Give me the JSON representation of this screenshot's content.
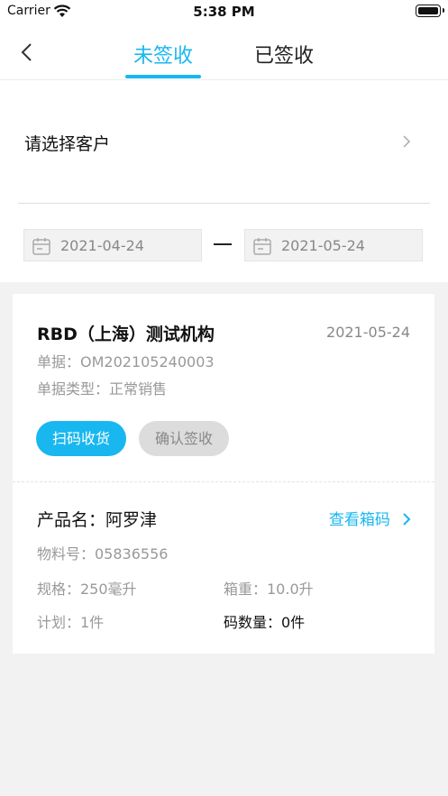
{
  "status_bar": {
    "carrier": "Carrier",
    "time": "5:38 PM"
  },
  "nav": {
    "tabs": [
      {
        "label": "未签收",
        "active": true
      },
      {
        "label": "已签收",
        "active": false
      }
    ]
  },
  "filter": {
    "customer_placeholder": "请选择客户",
    "date_start": "2021-04-24",
    "date_end": "2021-05-24"
  },
  "card": {
    "org_name": "RBD（上海）测试机构",
    "date": "2021-05-24",
    "doc_no": "单据：OM202105240003",
    "doc_type": "单据类型：正常销售",
    "scan_button": "扫码收货",
    "confirm_button": "确认签收",
    "product_name": "产品名：阿罗津",
    "view_box_code": "查看箱码",
    "material_no": "物料号：05836556",
    "spec": "规格：250毫升",
    "box_weight": "箱重：10.0升",
    "plan": "计划：1件",
    "code_qty": "码数量：0件"
  },
  "colors": {
    "accent": "#19b7f0",
    "background": "#f2f2f2"
  },
  "icons": [
    "wifi-icon",
    "battery-icon",
    "back-icon",
    "chevron-right-icon",
    "calendar-icon"
  ]
}
